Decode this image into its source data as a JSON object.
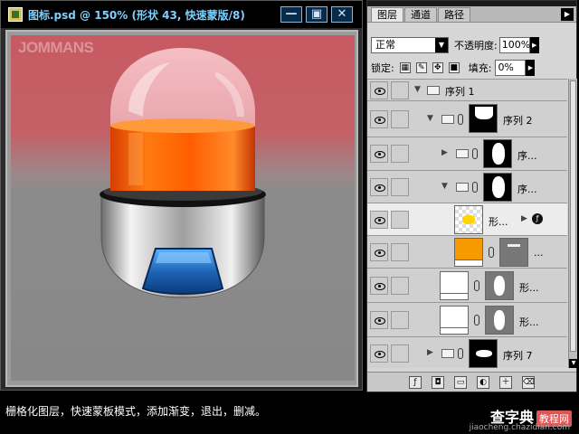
{
  "document": {
    "title": "图标.psd @ 150% (形状 43, 快速蒙版/8)",
    "watermark": "JOMMANS",
    "window_buttons": [
      "minimize",
      "maximize",
      "close"
    ]
  },
  "caption": {
    "text": "栅格化图层，快速蒙板模式，添加渐变，退出，删减。",
    "site_name": "查字典",
    "site_tag": "教程网",
    "site_url": "jiaocheng.chazidian.com"
  },
  "layers_panel": {
    "tabs": [
      "图层",
      "通道",
      "路径"
    ],
    "active_tab": "图层",
    "blend_mode": "正常",
    "opacity_label": "不透明度:",
    "opacity_value": "100%",
    "lock_label": "锁定:",
    "fill_label": "填充:",
    "fill_value": "0%",
    "layers": [
      {
        "name": "序列 1",
        "type": "group",
        "expanded": true,
        "indent": 0
      },
      {
        "name": "序列 2",
        "type": "group-with-mask",
        "expanded": true,
        "indent": 1
      },
      {
        "name": "序...",
        "type": "group-with-mask",
        "expanded": false,
        "indent": 2
      },
      {
        "name": "序...",
        "type": "group-with-mask",
        "expanded": true,
        "indent": 2
      },
      {
        "name": "形...",
        "type": "shape",
        "selected": true,
        "indent": 3
      },
      {
        "name": "...",
        "type": "fill-with-mask",
        "indent": 3
      },
      {
        "name": "形...",
        "type": "shape-with-mask",
        "indent": 2
      },
      {
        "name": "形...",
        "type": "shape-with-mask",
        "indent": 2
      },
      {
        "name": "序列 7",
        "type": "group-with-mask",
        "expanded": false,
        "indent": 1
      }
    ],
    "footer_icons": [
      "link-icon",
      "layer-style-icon",
      "mask-icon",
      "adjustment-icon",
      "new-group-icon",
      "new-layer-icon",
      "trash-icon"
    ]
  },
  "colors": {
    "title_text": "#7dd0ff",
    "liquid_orange": "#ff6a00",
    "button_blue": "#1e66b8",
    "canvas_top": "#c75a63"
  }
}
